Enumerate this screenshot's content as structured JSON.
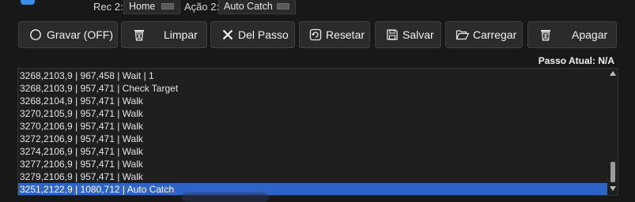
{
  "top": {
    "rec_label": "Rec 2:",
    "rec_value": "Home",
    "acao_label": "Ação 2:",
    "acao_value": "Auto Catch"
  },
  "toolbar": {
    "record_label": "Gravar (OFF)",
    "clear_label": "Limpar",
    "delete_step_label": "Del Passo",
    "reset_label": "Resetar",
    "save_label": "Salvar",
    "load_label": "Carregar",
    "erase_label": "Apagar"
  },
  "status": {
    "current_step": "Passo Atual: N/A"
  },
  "steps": [
    "3268,2103,9 | 967,458 | Wait | 1",
    "3268,2103,9 | 957,471 | Check Target",
    "3268,2104,9 | 957,471 | Walk",
    "3270,2105,9 | 957,471 | Walk",
    "3270,2106,9 | 957,471 | Walk",
    "3272,2106,9 | 957,471 | Walk",
    "3274,2106,9 | 957,471 | Walk",
    "3277,2106,9 | 957,471 | Walk",
    "3279,2106,9 | 957,471 | Walk",
    "3251,2122,9 | 1080,712 | Auto Catch"
  ],
  "selected_step_index": 9,
  "colors": {
    "selection": "#2f64c7",
    "background": "#181818",
    "button": "#2b2b2b",
    "accent": "#3a8fe8"
  }
}
